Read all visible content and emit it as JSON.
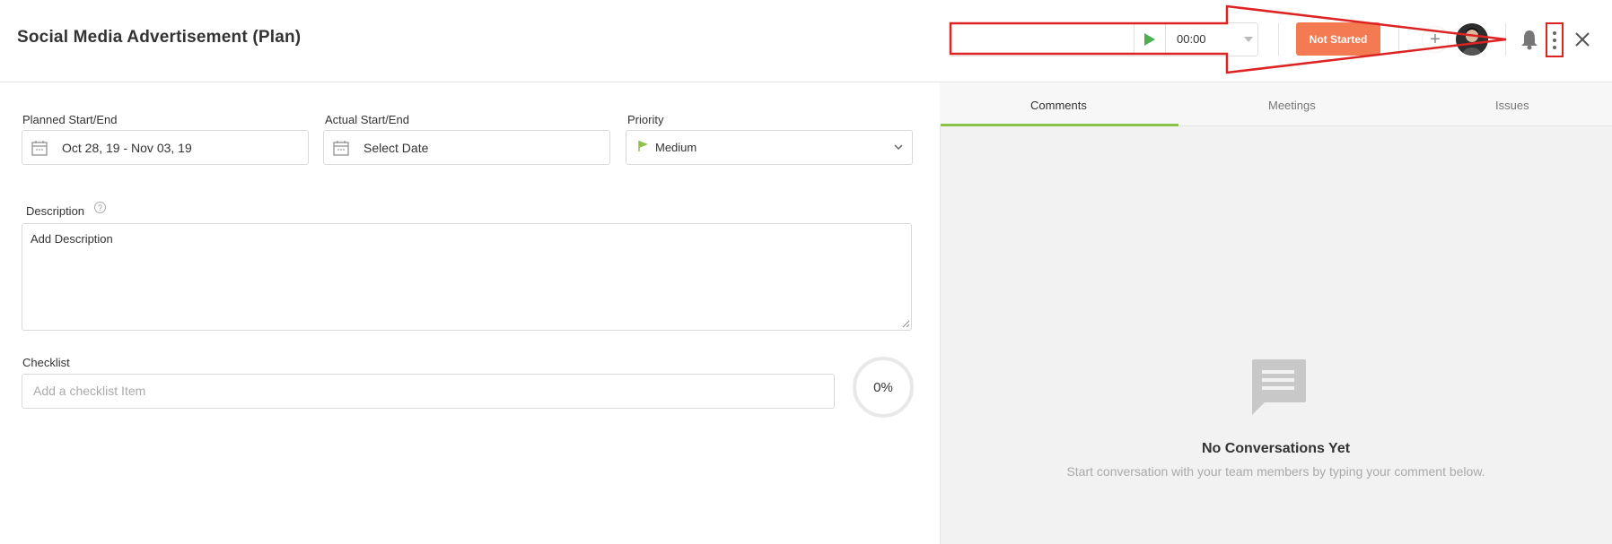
{
  "header": {
    "title": "Social Media Advertisement (Plan)",
    "timer": {
      "time": "00:00",
      "play_icon": "play-icon",
      "caret_icon": "caret-down-icon"
    },
    "status_label": "Not Started",
    "add_member_label": "+",
    "icons": {
      "bell": "bell-icon",
      "more": "more-vertical-icon",
      "close": "close-icon"
    }
  },
  "fields": {
    "planned": {
      "label": "Planned Start/End",
      "value": "Oct 28, 19 - Nov 03, 19"
    },
    "actual": {
      "label": "Actual Start/End",
      "value": "Select Date"
    },
    "priority": {
      "label": "Priority",
      "value": "Medium"
    }
  },
  "description": {
    "label": "Description",
    "help": "?",
    "placeholder": "Add Description"
  },
  "checklist": {
    "label": "Checklist",
    "placeholder": "Add a checklist Item",
    "progress": "0%"
  },
  "right": {
    "tabs": [
      "Comments",
      "Meetings",
      "Issues"
    ],
    "active_tab": "Comments",
    "empty_title": "No Conversations Yet",
    "empty_subtitle": "Start conversation with your team members by typing your comment below."
  },
  "colors": {
    "status": "#f47a52",
    "accent": "#8bc34a",
    "annotation": "#dd2222"
  }
}
